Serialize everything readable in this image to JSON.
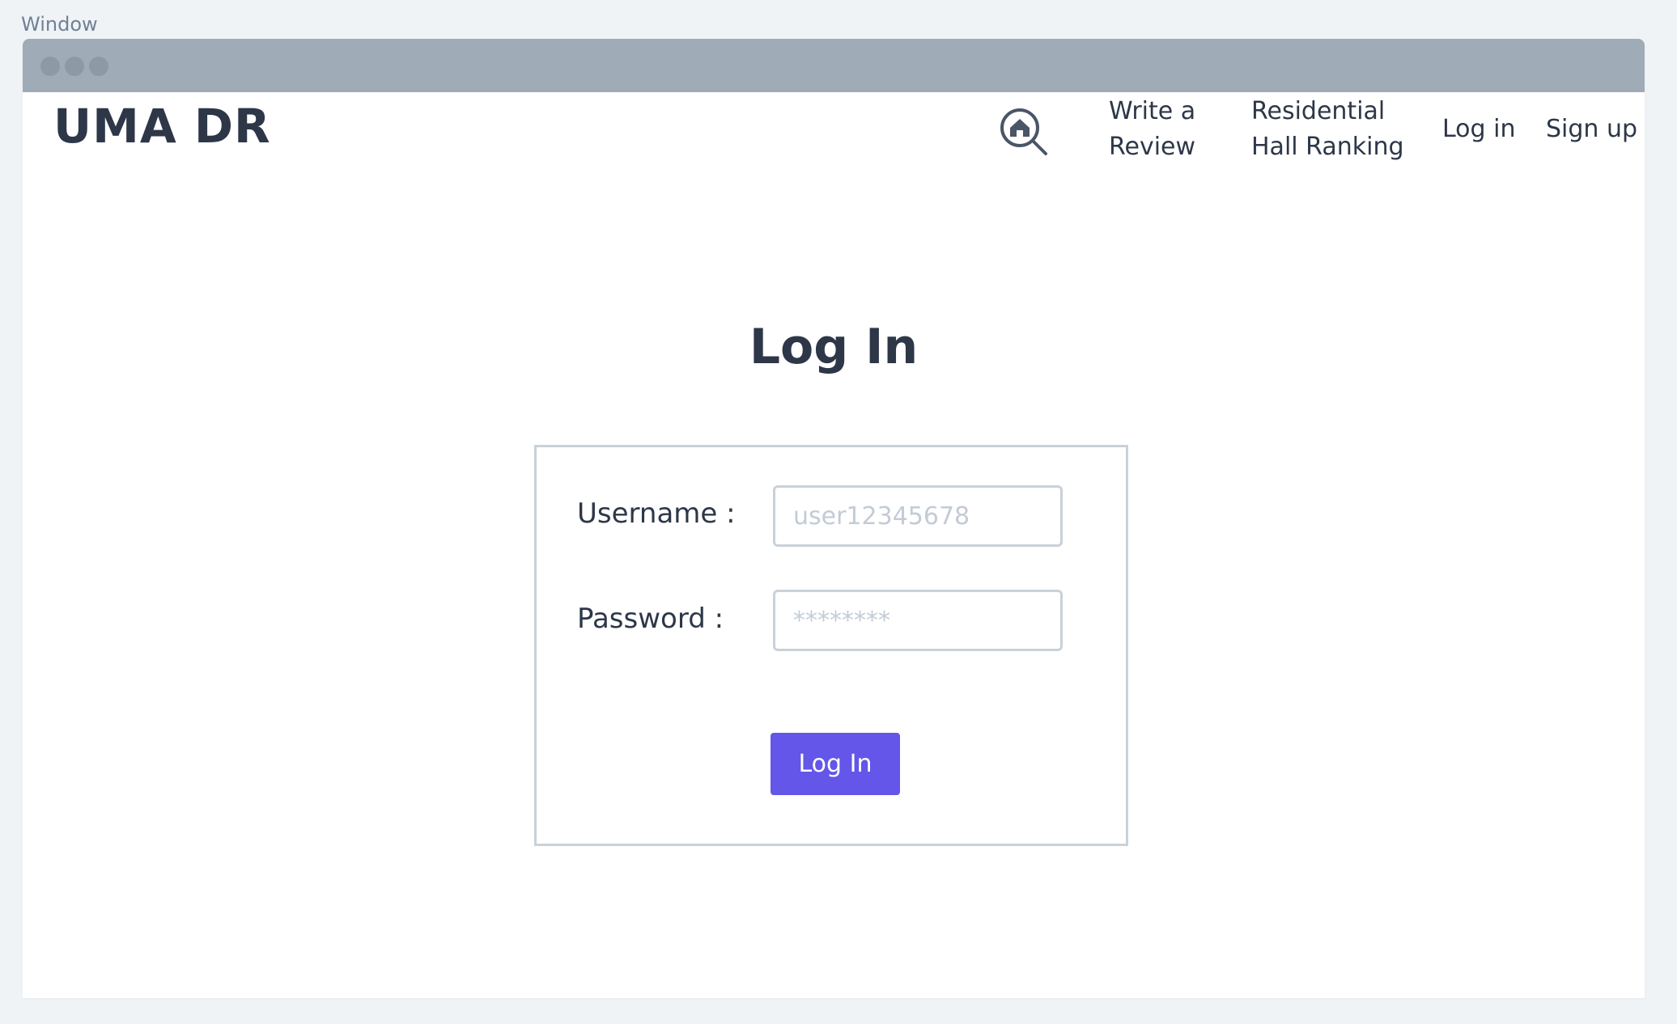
{
  "window": {
    "caption": "Window"
  },
  "header": {
    "logo": "UMA DR",
    "search_icon": "home-search-icon",
    "nav": {
      "write_review": "Write a\nReview",
      "ranking": "Residential\nHall Ranking",
      "login": "Log in",
      "signup": "Sign up"
    }
  },
  "main": {
    "title": "Log In",
    "form": {
      "username_label": "Username :",
      "username_placeholder": "user12345678",
      "password_label": "Password :",
      "password_placeholder": "********",
      "submit_label": "Log In"
    }
  },
  "colors": {
    "accent": "#6356e8",
    "text": "#2d3748",
    "border": "#c9d1da",
    "titlebar": "#a0abb8"
  }
}
